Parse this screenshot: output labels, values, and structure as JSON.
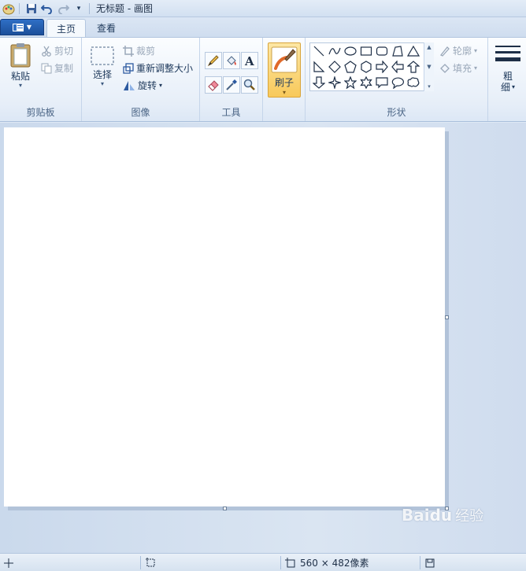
{
  "window": {
    "title": "无标题 - 画图"
  },
  "tabs": [
    {
      "label": "主页",
      "active": true
    },
    {
      "label": "查看",
      "active": false
    }
  ],
  "clipboard": {
    "paste_label": "粘贴",
    "cut_label": "剪切",
    "copy_label": "复制",
    "group_label": "剪贴板"
  },
  "image": {
    "select_label": "选择",
    "crop_label": "裁剪",
    "resize_label": "重新调整大小",
    "rotate_label": "旋转",
    "group_label": "图像"
  },
  "tools": {
    "group_label": "工具",
    "items": [
      "pencil-icon",
      "fill-icon",
      "text-icon",
      "eraser-icon",
      "color-picker-icon",
      "magnifier-icon"
    ]
  },
  "brush": {
    "label": "刷子"
  },
  "shapes": {
    "group_label": "形状",
    "outline_label": "轮廓",
    "fill_label": "填充"
  },
  "size": {
    "label_line1": "粗",
    "label_line2": "细"
  },
  "status": {
    "canvas_size": "560 × 482像素"
  },
  "colors": {
    "accent": "#1c4f9a",
    "brush_bg": "#f8c95a"
  }
}
